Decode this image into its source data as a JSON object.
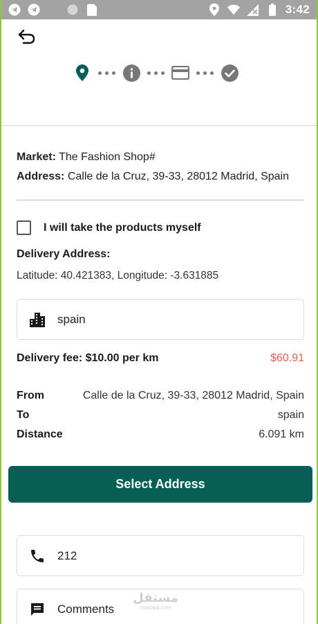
{
  "status_bar": {
    "time": "3:42",
    "left_icons": [
      "telegram-icon",
      "telegram-icon",
      "circle-icon",
      "sim-icon"
    ],
    "right_icons": [
      "location-icon",
      "wifi-icon",
      "signal-icon",
      "battery-icon"
    ]
  },
  "stepper": {
    "steps": [
      "location-pin-icon",
      "info-icon",
      "credit-card-icon",
      "check-circle-icon"
    ],
    "active_color": "#075e55",
    "inactive_color": "#777777"
  },
  "market": {
    "market_label": "Market:",
    "market_value": "The Fashion Shop#",
    "address_label": "Address:",
    "address_value": "Calle de la Cruz, 39-33, 28012 Madrid, Spain"
  },
  "pickup": {
    "label": "I will take the products myself",
    "checked": false
  },
  "delivery": {
    "title": "Delivery Address:",
    "coordinates": "Latitude: 40.421383, Longitude: -3.631885",
    "address_field_value": "spain",
    "fee_label": "Delivery fee: $10.00 per km",
    "fee_amount": "$60.91",
    "fee_color": "#e8604c"
  },
  "route": {
    "from_label": "From",
    "from_value": "Calle de la Cruz, 39-33, 28012 Madrid, Spain",
    "to_label": "To",
    "to_value": "spain",
    "distance_label": "Distance",
    "distance_value": "6.091 km"
  },
  "actions": {
    "select_address_label": "Select Address",
    "button_color": "#075e55"
  },
  "contact": {
    "phone_value": "212",
    "comments_placeholder": "Comments"
  },
  "watermark": {
    "arabic": "مستقل",
    "latin": "mostaql.com"
  }
}
